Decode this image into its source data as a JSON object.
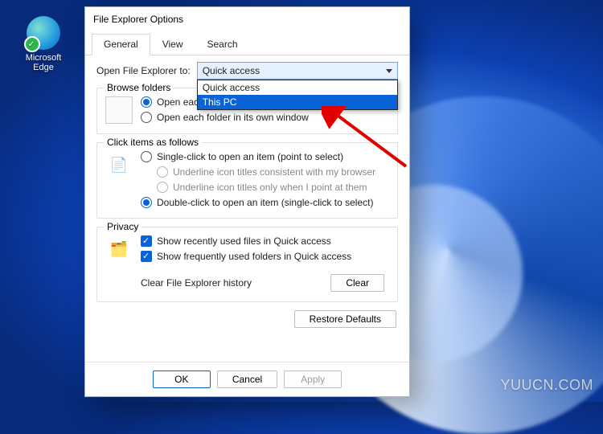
{
  "desktop": {
    "icon_label": "Microsoft\nEdge"
  },
  "watermark": "YUUCN.COM",
  "dialog": {
    "title": "File Explorer Options",
    "tabs": [
      "General",
      "View",
      "Search"
    ],
    "active_tab": 0,
    "open_label": "Open File Explorer to:",
    "combo_value": "Quick access",
    "combo_options": [
      "Quick access",
      "This PC"
    ],
    "combo_selected_index": 1,
    "group_browse": {
      "title": "Browse folders",
      "opt_same": "Open each folder in the same window",
      "opt_own": "Open each folder in its own window"
    },
    "group_click": {
      "title": "Click items as follows",
      "opt_single": "Single-click to open an item (point to select)",
      "opt_ul_browser": "Underline icon titles consistent with my browser",
      "opt_ul_point": "Underline icon titles only when I point at them",
      "opt_double": "Double-click to open an item (single-click to select)"
    },
    "group_privacy": {
      "title": "Privacy",
      "chk_recent": "Show recently used files in Quick access",
      "chk_frequent": "Show frequently used folders in Quick access",
      "clear_label": "Clear File Explorer history",
      "clear_btn": "Clear"
    },
    "restore_btn": "Restore Defaults",
    "footer": {
      "ok": "OK",
      "cancel": "Cancel",
      "apply": "Apply"
    }
  }
}
